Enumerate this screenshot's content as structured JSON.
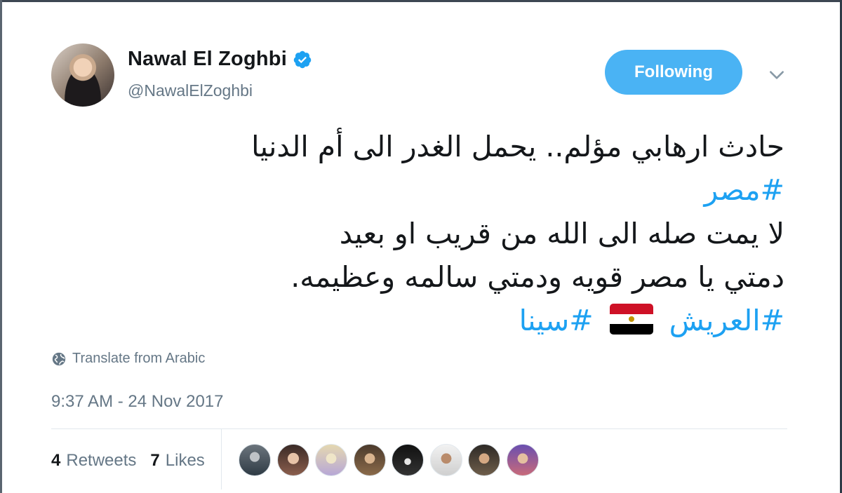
{
  "tweet": {
    "author": {
      "display_name": "Nawal El Zoghbi",
      "handle": "@NawalElZoghbi",
      "verified": true,
      "avatar_icon": "profile-photo"
    },
    "follow_button": "Following",
    "menu_icon": "chevron-down-icon",
    "text": {
      "line1": "حادث ارهابي مؤلم.. يحمل الغدر الى أم الدنيا",
      "line2_hashtag": "#مصر",
      "line3": "لا يمت صله الى الله من قريب او بعيد",
      "line4": "دمتي يا مصر قويه ودمتي سالمه وعظيمه.",
      "line5_hashtag1": "#العريش",
      "line5_flag": "🇪🇬",
      "line5_hashtag2": "#سينا"
    },
    "translate_label": "Translate from Arabic",
    "timestamp": "9:37 AM - 24 Nov 2017",
    "stats": {
      "retweets_count": "4",
      "retweets_label": "Retweets",
      "likes_count": "7",
      "likes_label": "Likes"
    },
    "likers_count_shown": 8
  },
  "colors": {
    "link": "#1da1f2",
    "follow_button_bg": "#4ab3f4",
    "secondary_text": "#657786",
    "primary_text": "#14171a",
    "verified_badge": "#1da1f2"
  }
}
